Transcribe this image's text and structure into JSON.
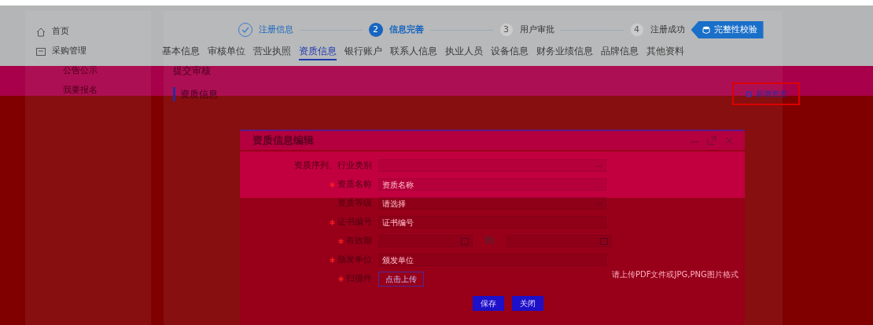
{
  "sidebar": {
    "items": [
      {
        "label": "首页",
        "kind": "home"
      },
      {
        "label": "采购管理",
        "kind": "folder"
      },
      {
        "label": "公告公示",
        "kind": "sub"
      },
      {
        "label": "我要报名",
        "kind": "sub"
      }
    ]
  },
  "steps": [
    {
      "label": "注册信息",
      "completed": true,
      "selected": false
    },
    {
      "number": "2",
      "label": "信息完善",
      "completed": false,
      "selected": true
    },
    {
      "number": "3",
      "label": "用户审批",
      "completed": false,
      "selected": false
    },
    {
      "number": "4",
      "label": "注册成功",
      "completed": false,
      "selected": false
    }
  ],
  "check_button": "完整性校验",
  "tabs": [
    {
      "label": "基本信息",
      "selected": false
    },
    {
      "label": "审核单位",
      "selected": false
    },
    {
      "label": "营业执照",
      "selected": false
    },
    {
      "label": "资质信息",
      "selected": true
    },
    {
      "label": "银行账户",
      "selected": false
    },
    {
      "label": "联系人信息",
      "selected": false
    },
    {
      "label": "执业人员",
      "selected": false
    },
    {
      "label": "设备信息",
      "selected": false
    },
    {
      "label": "财务业绩信息",
      "selected": false
    },
    {
      "label": "品牌信息",
      "selected": false
    },
    {
      "label": "其他资料",
      "selected": false
    }
  ],
  "submit_link": "提交审核",
  "section_title": "资质信息",
  "add_button": "新增资质",
  "dialog": {
    "title": "资质信息编辑",
    "fields": [
      {
        "kind": "picker",
        "label": "资质序列、行业类别",
        "required": false,
        "button": "···"
      },
      {
        "kind": "text",
        "label": "资质名称",
        "required": true,
        "placeholder": "资质名称"
      },
      {
        "kind": "select",
        "label": "资质等级",
        "required": false,
        "placeholder": "请选择"
      },
      {
        "kind": "text",
        "label": "证书编号",
        "required": true,
        "placeholder": "证书编号"
      },
      {
        "kind": "daterange",
        "label": "有效期",
        "required": true,
        "separator": "到"
      },
      {
        "kind": "text",
        "label": "颁发单位",
        "required": true,
        "placeholder": "颁发单位"
      },
      {
        "kind": "upload",
        "label": "扫描件",
        "required": true,
        "button": "点击上传",
        "hint": "请上传PDF文件或JPG,PNG图片格式"
      }
    ],
    "buttons": [
      "保存",
      "关闭"
    ]
  }
}
